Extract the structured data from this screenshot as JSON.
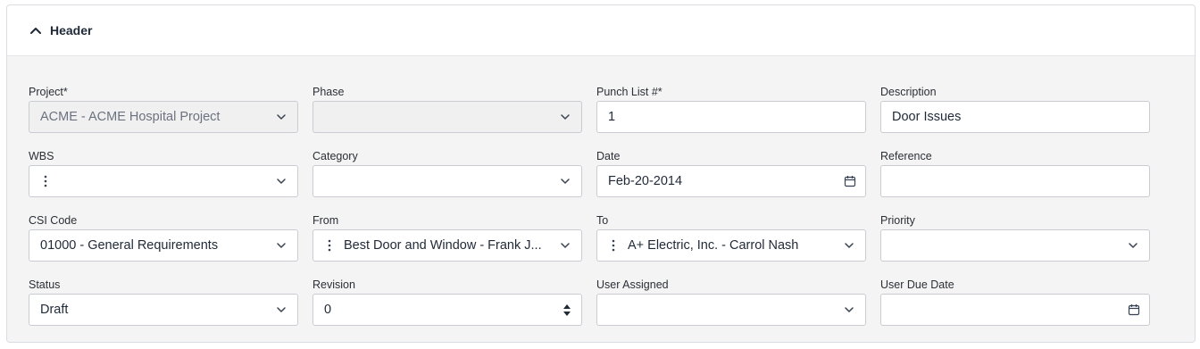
{
  "header": {
    "title": "Header"
  },
  "fields": {
    "project": {
      "label": "Project*",
      "value": "ACME - ACME Hospital Project"
    },
    "phase": {
      "label": "Phase",
      "value": ""
    },
    "punch_list": {
      "label": "Punch List #*",
      "value": "1"
    },
    "description": {
      "label": "Description",
      "value": "Door Issues"
    },
    "wbs": {
      "label": "WBS",
      "value": ""
    },
    "category": {
      "label": "Category",
      "value": ""
    },
    "date": {
      "label": "Date",
      "value": "Feb-20-2014"
    },
    "reference": {
      "label": "Reference",
      "value": ""
    },
    "csi_code": {
      "label": "CSI Code",
      "value": "01000 - General Requirements"
    },
    "from": {
      "label": "From",
      "value": "Best Door and Window - Frank J..."
    },
    "to": {
      "label": "To",
      "value": "A+ Electric, Inc. - Carrol Nash"
    },
    "priority": {
      "label": "Priority",
      "value": ""
    },
    "status": {
      "label": "Status",
      "value": "Draft"
    },
    "revision": {
      "label": "Revision",
      "value": "0"
    },
    "user_assigned": {
      "label": "User Assigned",
      "value": ""
    },
    "user_due_date": {
      "label": "User Due Date",
      "value": ""
    }
  },
  "icons": {
    "collapse": "chevron-up-icon",
    "dropdown": "chevron-down-icon",
    "calendar": "calendar-icon",
    "tree": "kebab-icon",
    "spinner": "stepper-arrows-icon"
  },
  "colors": {
    "panel_bg": "#f4f4f4",
    "border": "#c9ccd1",
    "disabled_bg": "#f0f0f0"
  }
}
